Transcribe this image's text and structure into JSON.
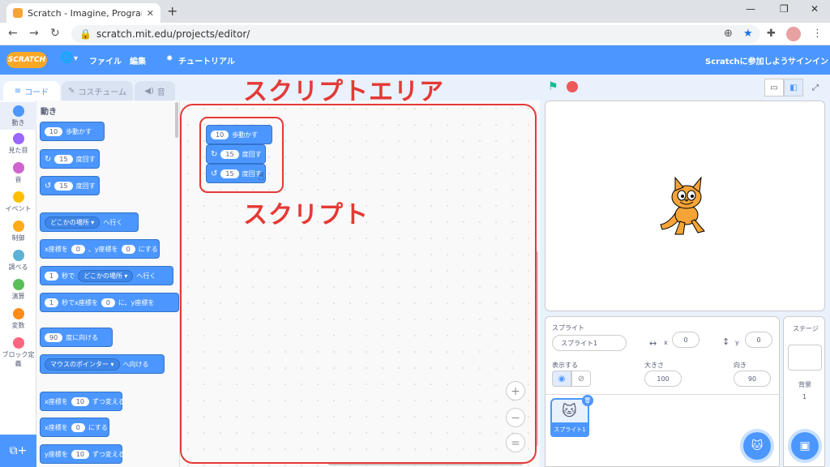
{
  "browser": {
    "tab_title": "Scratch - Imagine, Program, Shar",
    "tab_close": "✕",
    "new_tab": "+",
    "minimize": "—",
    "restore": "❐",
    "close": "✕",
    "url": "scratch.mit.edu/projects/editor/"
  },
  "menu": {
    "logo": "SCRATCH",
    "globe_arrow": "▾",
    "file": "ファイル",
    "edit": "編集",
    "tutorial": "チュートリアル",
    "join": "Scratchに参加しよう",
    "signin": "サインイン"
  },
  "editor_tabs": {
    "code": "コード",
    "costume": "コスチューム",
    "sound": "音"
  },
  "categories": [
    {
      "label": "動き",
      "color": "#4c97ff"
    },
    {
      "label": "見た目",
      "color": "#9966ff"
    },
    {
      "label": "音",
      "color": "#cf63cf"
    },
    {
      "label": "イベント",
      "color": "#ffbf00"
    },
    {
      "label": "制御",
      "color": "#ffab19"
    },
    {
      "label": "調べる",
      "color": "#5cb1d6"
    },
    {
      "label": "演算",
      "color": "#59c059"
    },
    {
      "label": "変数",
      "color": "#ff8c1a"
    },
    {
      "label": "ブロック定義",
      "color": "#ff6680"
    }
  ],
  "palette": {
    "title": "動き",
    "move_num": "10",
    "move_txt": "歩動かす",
    "turn_r_num": "15",
    "turn_r_txt": "度回す",
    "turn_l_num": "15",
    "turn_l_txt": "度回す",
    "goto_drop": "どこかの場所 ▾",
    "goto_txt": "へ行く",
    "gotoxy_a": "x座標を",
    "gotoxy_x": "0",
    "gotoxy_b": "、y座標を",
    "gotoxy_y": "0",
    "gotoxy_c": "にする",
    "glide_num": "1",
    "glide_a": "秒で",
    "glide_drop": "どこかの場所 ▾",
    "glide_b": "へ行く",
    "glidexy_num": "1",
    "glidexy_a": "秒でx座標を",
    "glidexy_x": "0",
    "glidexy_b": "に、y座標を",
    "point_num": "90",
    "point_txt": "度に向ける",
    "towards_drop": "マウスのポインター ▾",
    "towards_txt": "へ向ける",
    "changex_a": "x座標を",
    "changex_num": "10",
    "changex_b": "ずつ変える",
    "setx_a": "x座標を",
    "setx_num": "0",
    "setx_b": "にする",
    "changey_a": "y座標を",
    "changey_num": "10",
    "changey_b": "ずつ変える"
  },
  "script": {
    "move_num": "10",
    "move_txt": "歩動かす",
    "turn_r_num": "15",
    "turn_r_txt": "度回す",
    "turn_l_num": "15",
    "turn_l_txt": "度回す"
  },
  "annotations": {
    "area": "スクリプトエリア",
    "script": "スクリプト"
  },
  "sprite": {
    "label": "スプライト",
    "name": "スプライト1",
    "x": "0",
    "y": "0",
    "show": "表示する",
    "size_label": "大きさ",
    "size": "100",
    "dir_label": "向き",
    "direction": "90",
    "thumb_name": "スプライト1"
  },
  "stage": {
    "label": "ステージ",
    "backdrops_label": "背景",
    "backdrops_count": "1"
  }
}
